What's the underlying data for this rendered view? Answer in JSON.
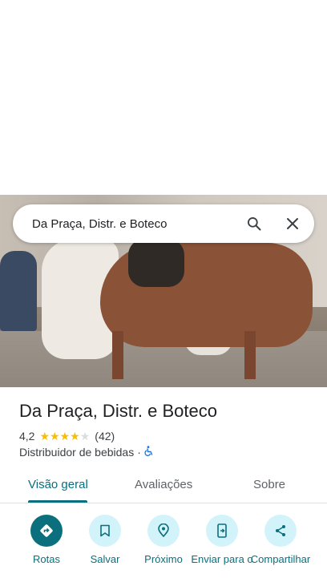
{
  "search": {
    "query": "Da Praça, Distr. e Boteco"
  },
  "place": {
    "name": "Da Praça, Distr. e Boteco",
    "rating": "4,2",
    "rating_value": 4.2,
    "review_count": "(42)",
    "category": "Distribuidor de bebidas",
    "separator": "·"
  },
  "tabs": [
    {
      "label": "Visão geral",
      "active": true
    },
    {
      "label": "Avaliações",
      "active": false
    },
    {
      "label": "Sobre",
      "active": false
    }
  ],
  "actions": [
    {
      "label": "Rotas",
      "icon": "directions-icon"
    },
    {
      "label": "Salvar",
      "icon": "bookmark-icon"
    },
    {
      "label": "Próximo",
      "icon": "nearby-icon"
    },
    {
      "label": "Enviar para o",
      "icon": "send-to-phone-icon"
    },
    {
      "label": "Compartilhar",
      "icon": "share-icon"
    }
  ],
  "colors": {
    "accent": "#0b6f7d",
    "action_bg": "#d3f3fb",
    "star": "#fbbc04",
    "accessibility": "#1a73e8"
  }
}
